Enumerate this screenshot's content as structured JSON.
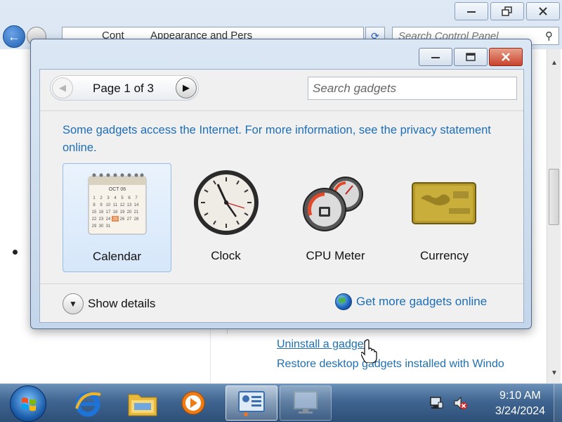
{
  "control_panel": {
    "breadcrumb": [
      "Cont",
      "Appearance and Pers"
    ],
    "search_placeholder": "Search Control Panel",
    "links": {
      "uninstall": "Uninstall a gadget",
      "restore": "Restore desktop gadgets installed with Windo"
    }
  },
  "gadgets_dialog": {
    "pager": {
      "label": "Page 1 of 3"
    },
    "search_placeholder": "Search gadgets",
    "notice": "Some gadgets access the Internet.  For more information, see the privacy statement online.",
    "gadgets": [
      {
        "label": "Calendar",
        "icon": "calendar-icon",
        "selected": true,
        "calendar_header": "OCT 06"
      },
      {
        "label": "Clock",
        "icon": "clock-icon",
        "selected": false
      },
      {
        "label": "CPU Meter",
        "icon": "cpu-meter-icon",
        "selected": false
      },
      {
        "label": "Currency",
        "icon": "currency-icon",
        "selected": false
      }
    ],
    "show_details": "Show details",
    "get_more": "Get more gadgets online"
  },
  "taskbar": {
    "time": "9:10 AM",
    "date": "3/24/2024",
    "apps": [
      "start-button",
      "internet-explorer",
      "windows-explorer",
      "media-player",
      "gadgets",
      "desktop"
    ]
  },
  "colors": {
    "link": "#1e6eb5",
    "close_button": "#c9432c",
    "taskbar": "#3f6590"
  }
}
